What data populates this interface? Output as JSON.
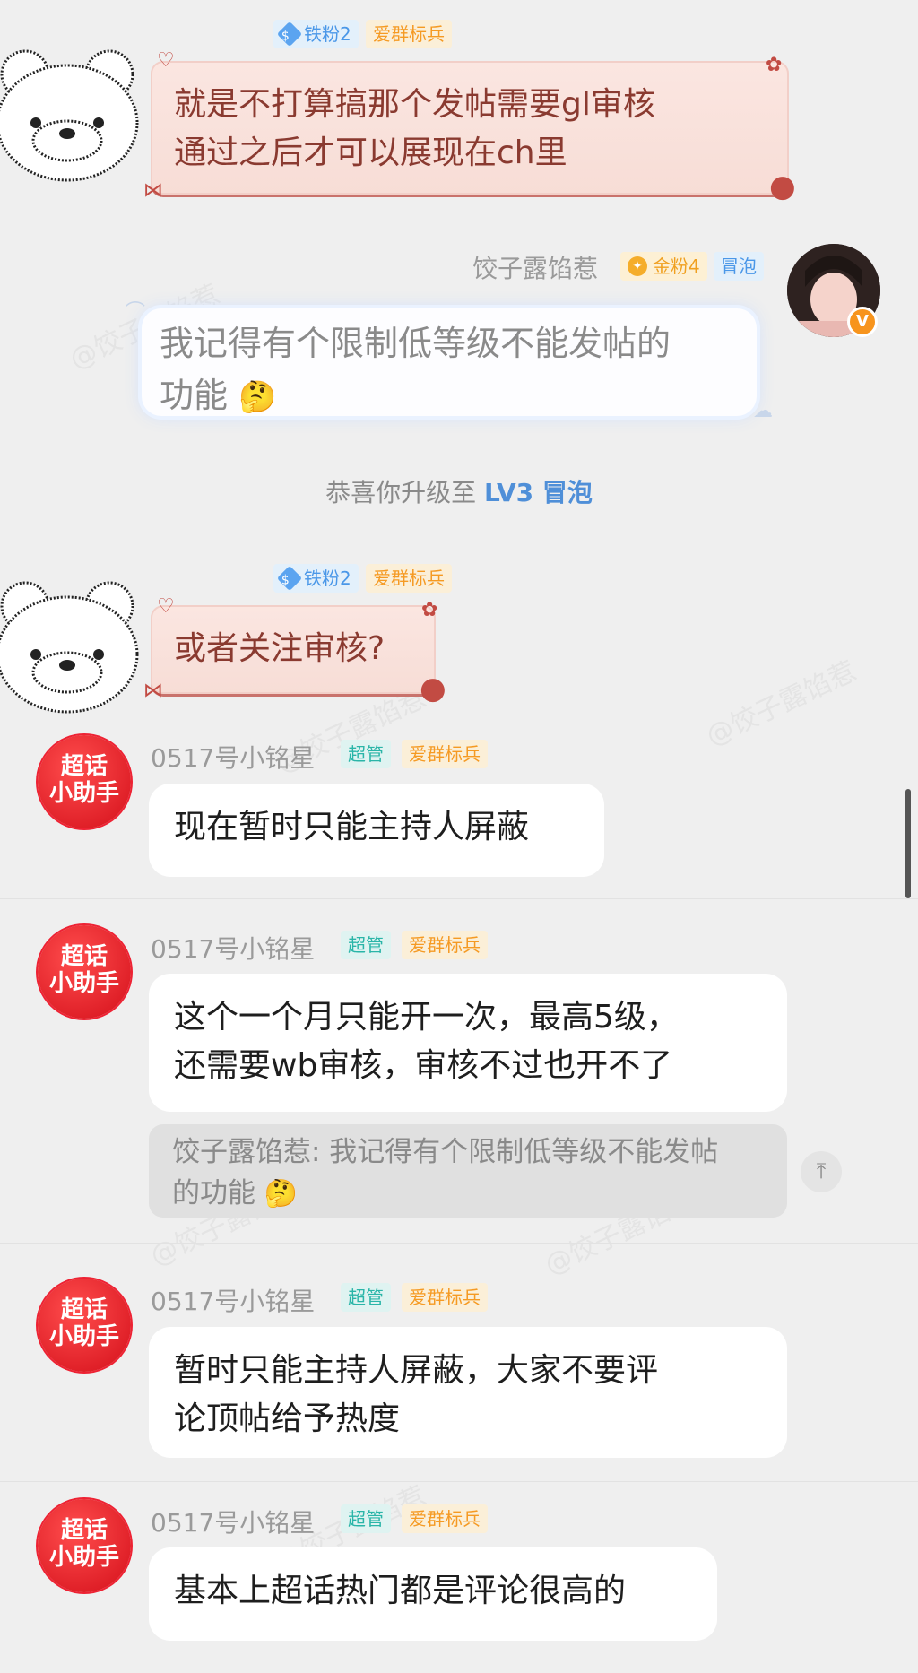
{
  "messages": [
    {
      "badges": {
        "iron": "铁粉2",
        "love": "爱群标兵"
      },
      "text_line1": "就是不打算搞那个发帖需要gl审核",
      "text_line2": "通过之后才可以展现在ch里"
    },
    {
      "sender": "饺子露馅惹",
      "badges": {
        "gold": "金粉4",
        "bubble": "冒泡"
      },
      "text_line1": "我记得有个限制低等级不能发帖的",
      "text_line2": "功能",
      "emoji": "🤔"
    },
    {
      "badges": {
        "iron": "铁粉2",
        "love": "爱群标兵"
      },
      "text": "或者关注审核?"
    },
    {
      "sender": "0517号小铭星",
      "badges": {
        "admin": "超管",
        "love": "爱群标兵"
      },
      "text": "现在暂时只能主持人屏蔽"
    },
    {
      "sender": "0517号小铭星",
      "badges": {
        "admin": "超管",
        "love": "爱群标兵"
      },
      "text_line1": "这个一个月只能开一次，最高5级，",
      "text_line2": "还需要wb审核，审核不过也开不了",
      "quote_line1": "饺子露馅惹: 我记得有个限制低等级不能发帖",
      "quote_line2": "的功能",
      "quote_emoji": "🤔"
    },
    {
      "sender": "0517号小铭星",
      "badges": {
        "admin": "超管",
        "love": "爱群标兵"
      },
      "text_line1": "暂时只能主持人屏蔽，大家不要评",
      "text_line2": "论顶帖给予热度"
    },
    {
      "sender": "0517号小铭星",
      "badges": {
        "admin": "超管",
        "love": "爱群标兵"
      },
      "text": "基本上超话热门都是评论很高的"
    }
  ],
  "system": {
    "prefix": "恭喜你升级至 ",
    "level": "LV3 冒泡"
  },
  "helper_avatar": {
    "line1": "超话",
    "line2": "小助手"
  },
  "verified_mark": "V",
  "scroll_top_icon": "arrow-up-to-top-icon",
  "colors": {
    "love_badge": "#f59a23",
    "admin_badge": "#2ab5a8",
    "iron_badge": "#4a97e8",
    "level": "#4f8fd8"
  }
}
